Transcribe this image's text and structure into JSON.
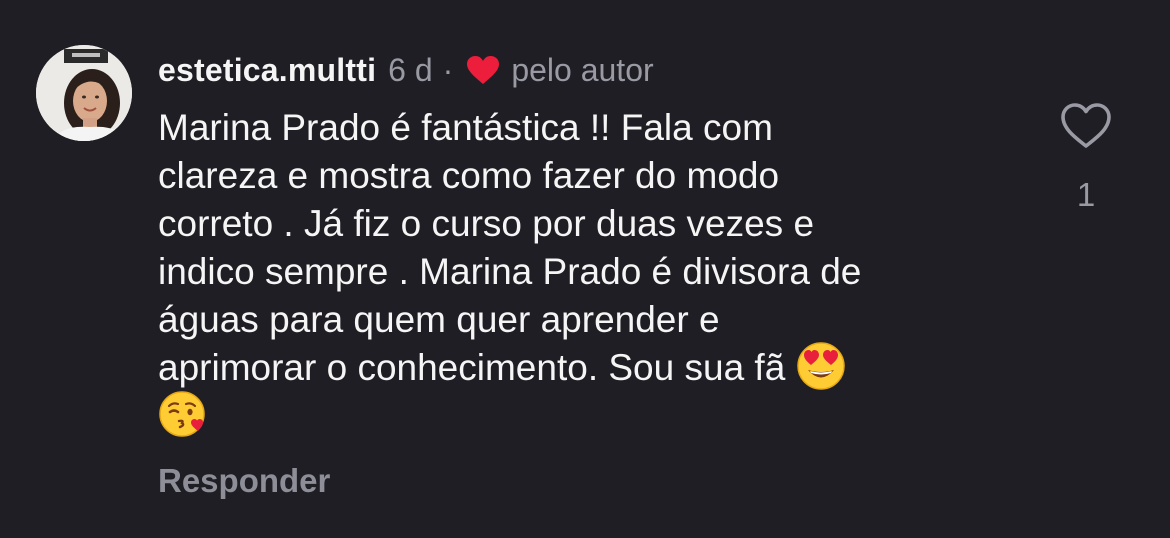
{
  "comment": {
    "username": "estetica.multti",
    "time_ago": "6 d",
    "separator": "·",
    "liked_by_author_label": "pelo autor",
    "text_lines": [
      "Marina Prado é fantástica !! Fala com",
      "clareza e mostra como fazer do modo",
      "correto . Já fiz o curso por duas vezes e",
      "indico sempre . Marina Prado é divisora de",
      "águas para quem quer aprender e",
      "aprimorar o conhecimento. Sou sua fã"
    ],
    "emojis": [
      "heart-eyes-emoji",
      "kissing-face-emoji"
    ],
    "like_count": "1",
    "reply_label": "Responder"
  },
  "icons": {
    "avatar": "avatar",
    "author_heart": "red-heart-icon",
    "like": "heart-outline-icon"
  },
  "colors": {
    "background": "#1e1e24",
    "text_primary": "#f5f5f5",
    "text_secondary": "#9a9aa4",
    "author_heart": "#ed1d3c"
  }
}
